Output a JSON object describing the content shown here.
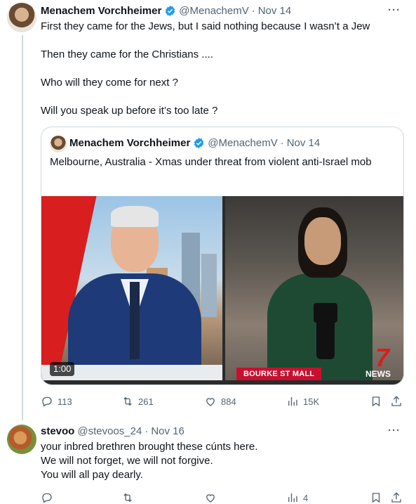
{
  "tweet": {
    "author_name": "Menachem Vorchheimer",
    "handle": "@MenachemV",
    "date": "Nov 14",
    "lines": [
      "First they came for the Jews, but I said nothing because I wasn’t a Jew",
      "Then they came for the Christians ....",
      "Who will they come for next ?",
      "Will you speak up before it’s too late ?"
    ],
    "quote": {
      "author_name": "Menachem Vorchheimer",
      "handle": "@MenachemV",
      "date": "Nov 14",
      "text": "Melbourne, Australia - Xmas under threat from violent anti-Israel mob",
      "video_duration": "1:00",
      "location_caption": "BOURKE ST MALL",
      "channel_logo_number": "7",
      "channel_logo_text": "NEWS"
    },
    "stats": {
      "replies": "113",
      "retweets": "261",
      "likes": "884",
      "views": "15K"
    }
  },
  "reply": {
    "author_name": "stevoo",
    "handle": "@stevoos_24",
    "date": "Nov 16",
    "lines": [
      "your inbred brethren brought these cúnts here.",
      "We will not forget, we will not forgive.",
      "You will all pay dearly."
    ],
    "stats": {
      "views": "4"
    }
  },
  "colors": {
    "verified": "#1d9bf0",
    "muted": "#536471",
    "border": "#cfd9de",
    "location_red": "#c8102e"
  },
  "icons": [
    "more-icon",
    "verified-badge-icon",
    "reply-icon",
    "retweet-icon",
    "like-icon",
    "views-icon",
    "bookmark-icon",
    "share-icon"
  ]
}
